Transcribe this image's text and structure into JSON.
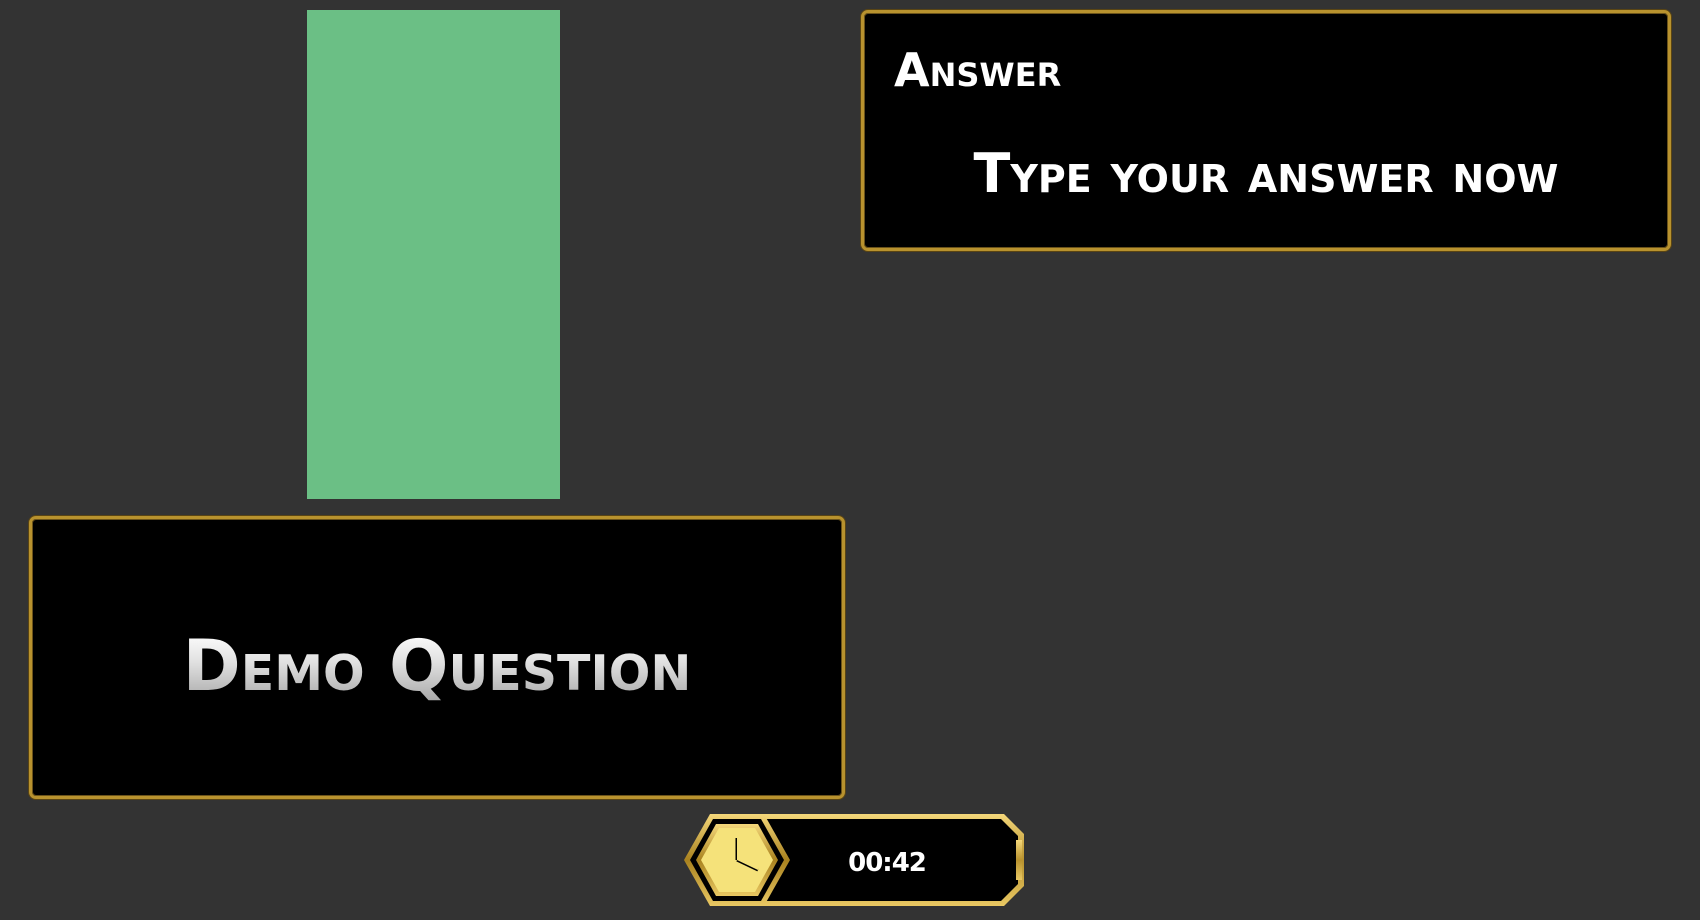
{
  "answer": {
    "title": "Answer",
    "prompt": "Type your answer now"
  },
  "question": {
    "text": "Demo Question"
  },
  "timer": {
    "value": "00:42",
    "icon": "clock-icon"
  },
  "colors": {
    "background": "#333333",
    "panel": "#000000",
    "gold_border": "#b8922e",
    "image_placeholder": "#6bbf85",
    "clock_fill": "#f5e27a"
  }
}
